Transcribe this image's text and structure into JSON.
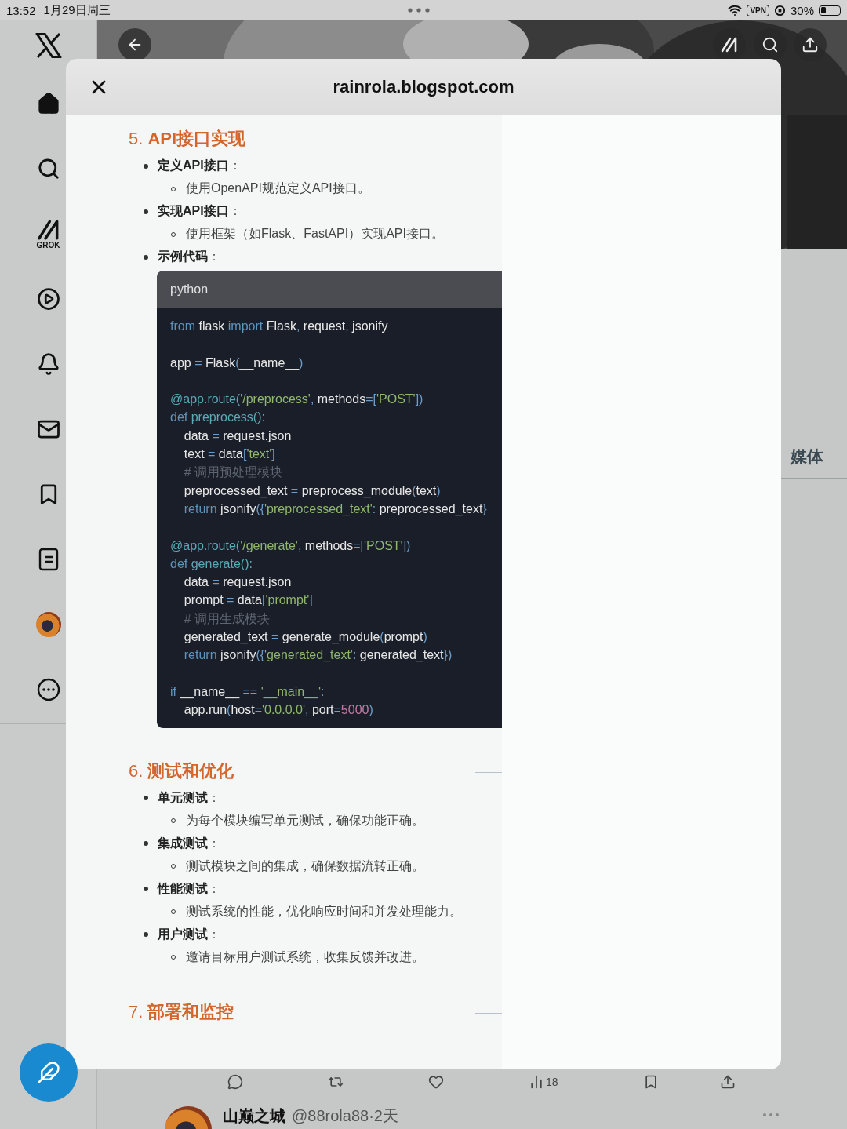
{
  "status_bar": {
    "time": "13:52",
    "date": "1月29日周三",
    "vpn": "VPN",
    "battery": "30%"
  },
  "sidebar": {
    "grok_label": "GROK"
  },
  "profile": {
    "tab": "媒体"
  },
  "tweet_actions": {
    "views": "18"
  },
  "next_tweet": {
    "author": "山巅之城",
    "handle_time": "@88rola88·2天"
  },
  "modal": {
    "title": "rainrola.blogspot.com",
    "sections": [
      {
        "heading": "5. **API接口实现**",
        "items": [
          {
            "label": "**定义API接口**：",
            "children": [
              {
                "text": "使用OpenAPI规范定义API接口。"
              }
            ]
          },
          {
            "label": "**实现API接口**：",
            "children": [
              {
                "text": "使用框架（如Flask、FastAPI）实现API接口。"
              }
            ]
          },
          {
            "label": "**示例代码**：",
            "code": {
              "language": "python",
              "lines": [
                {
                  "gap": false,
                  "tokens": [
                    {
                      "kind": "kw",
                      "text": "from"
                    },
                    {
                      "kind": "plain",
                      "text": " flask "
                    },
                    {
                      "kind": "kw",
                      "text": "import"
                    },
                    {
                      "kind": "plain",
                      "text": " Flask"
                    },
                    {
                      "kind": "op",
                      "text": ","
                    },
                    {
                      "kind": "plain",
                      "text": " request"
                    },
                    {
                      "kind": "op",
                      "text": ","
                    },
                    {
                      "kind": "plain",
                      "text": " jsonify"
                    }
                  ]
                },
                {
                  "gap": true,
                  "tokens": [
                    {
                      "kind": "plain",
                      "text": "app "
                    },
                    {
                      "kind": "op",
                      "text": "="
                    },
                    {
                      "kind": "plain",
                      "text": " Flask"
                    },
                    {
                      "kind": "op",
                      "text": "("
                    },
                    {
                      "kind": "plain",
                      "text": "__name__"
                    },
                    {
                      "kind": "op",
                      "text": ")"
                    }
                  ]
                },
                {
                  "gap": true,
                  "tokens": [
                    {
                      "kind": "fn",
                      "text": "@app.route("
                    },
                    {
                      "kind": "str",
                      "text": "'/preprocess'"
                    },
                    {
                      "kind": "op",
                      "text": ","
                    },
                    {
                      "kind": "plain",
                      "text": " methods"
                    },
                    {
                      "kind": "op",
                      "text": "=["
                    },
                    {
                      "kind": "str",
                      "text": "'POST'"
                    },
                    {
                      "kind": "op",
                      "text": "])"
                    }
                  ]
                },
                {
                  "gap": false,
                  "tokens": [
                    {
                      "kind": "kw",
                      "text": "def"
                    },
                    {
                      "kind": "fn",
                      "text": " preprocess():"
                    }
                  ]
                },
                {
                  "gap": false,
                  "tokens": [
                    {
                      "kind": "plain",
                      "text": "    data "
                    },
                    {
                      "kind": "op",
                      "text": "="
                    },
                    {
                      "kind": "plain",
                      "text": " request.json"
                    }
                  ]
                },
                {
                  "gap": false,
                  "tokens": [
                    {
                      "kind": "plain",
                      "text": "    text "
                    },
                    {
                      "kind": "op",
                      "text": "="
                    },
                    {
                      "kind": "plain",
                      "text": " data"
                    },
                    {
                      "kind": "op",
                      "text": "["
                    },
                    {
                      "kind": "str",
                      "text": "'text'"
                    },
                    {
                      "kind": "op",
                      "text": "]"
                    }
                  ]
                },
                {
                  "gap": false,
                  "tokens": [
                    {
                      "kind": "comment",
                      "text": "    # 调用预处理模块"
                    }
                  ]
                },
                {
                  "gap": false,
                  "tokens": [
                    {
                      "kind": "plain",
                      "text": "    preprocessed_text "
                    },
                    {
                      "kind": "op",
                      "text": "="
                    },
                    {
                      "kind": "plain",
                      "text": " preprocess_module"
                    },
                    {
                      "kind": "op",
                      "text": "("
                    },
                    {
                      "kind": "plain",
                      "text": "text"
                    },
                    {
                      "kind": "op",
                      "text": ")"
                    }
                  ]
                },
                {
                  "gap": false,
                  "tokens": [
                    {
                      "kind": "kw",
                      "text": "    return"
                    },
                    {
                      "kind": "plain",
                      "text": " jsonify"
                    },
                    {
                      "kind": "op",
                      "text": "({"
                    },
                    {
                      "kind": "str",
                      "text": "'preprocessed_text'"
                    },
                    {
                      "kind": "op",
                      "text": ":"
                    },
                    {
                      "kind": "plain",
                      "text": " preprocessed_text"
                    },
                    {
                      "kind": "op",
                      "text": "}"
                    }
                  ]
                },
                {
                  "gap": true,
                  "tokens": [
                    {
                      "kind": "fn",
                      "text": "@app.route("
                    },
                    {
                      "kind": "str",
                      "text": "'/generate'"
                    },
                    {
                      "kind": "op",
                      "text": ","
                    },
                    {
                      "kind": "plain",
                      "text": " methods"
                    },
                    {
                      "kind": "op",
                      "text": "=["
                    },
                    {
                      "kind": "str",
                      "text": "'POST'"
                    },
                    {
                      "kind": "op",
                      "text": "])"
                    }
                  ]
                },
                {
                  "gap": false,
                  "tokens": [
                    {
                      "kind": "kw",
                      "text": "def"
                    },
                    {
                      "kind": "fn",
                      "text": " generate():"
                    }
                  ]
                },
                {
                  "gap": false,
                  "tokens": [
                    {
                      "kind": "plain",
                      "text": "    data "
                    },
                    {
                      "kind": "op",
                      "text": "="
                    },
                    {
                      "kind": "plain",
                      "text": " request.json"
                    }
                  ]
                },
                {
                  "gap": false,
                  "tokens": [
                    {
                      "kind": "plain",
                      "text": "    prompt "
                    },
                    {
                      "kind": "op",
                      "text": "="
                    },
                    {
                      "kind": "plain",
                      "text": " data"
                    },
                    {
                      "kind": "op",
                      "text": "["
                    },
                    {
                      "kind": "str",
                      "text": "'prompt'"
                    },
                    {
                      "kind": "op",
                      "text": "]"
                    }
                  ]
                },
                {
                  "gap": false,
                  "tokens": [
                    {
                      "kind": "comment",
                      "text": "    # 调用生成模块"
                    }
                  ]
                },
                {
                  "gap": false,
                  "tokens": [
                    {
                      "kind": "plain",
                      "text": "    generated_text "
                    },
                    {
                      "kind": "op",
                      "text": "="
                    },
                    {
                      "kind": "plain",
                      "text": " generate_module"
                    },
                    {
                      "kind": "op",
                      "text": "("
                    },
                    {
                      "kind": "plain",
                      "text": "prompt"
                    },
                    {
                      "kind": "op",
                      "text": ")"
                    }
                  ]
                },
                {
                  "gap": false,
                  "tokens": [
                    {
                      "kind": "kw",
                      "text": "    return"
                    },
                    {
                      "kind": "plain",
                      "text": " jsonify"
                    },
                    {
                      "kind": "op",
                      "text": "({"
                    },
                    {
                      "kind": "str",
                      "text": "'generated_text'"
                    },
                    {
                      "kind": "op",
                      "text": ":"
                    },
                    {
                      "kind": "plain",
                      "text": " generated_text"
                    },
                    {
                      "kind": "op",
                      "text": "})"
                    }
                  ]
                },
                {
                  "gap": true,
                  "tokens": [
                    {
                      "kind": "kw",
                      "text": "if"
                    },
                    {
                      "kind": "plain",
                      "text": " __name__ "
                    },
                    {
                      "kind": "op",
                      "text": "=="
                    },
                    {
                      "kind": "str",
                      "text": " '__main__'"
                    },
                    {
                      "kind": "op",
                      "text": ":"
                    }
                  ]
                },
                {
                  "gap": false,
                  "tokens": [
                    {
                      "kind": "plain",
                      "text": "    app.run"
                    },
                    {
                      "kind": "op",
                      "text": "("
                    },
                    {
                      "kind": "plain",
                      "text": "host"
                    },
                    {
                      "kind": "op",
                      "text": "="
                    },
                    {
                      "kind": "str",
                      "text": "'0.0.0.0'"
                    },
                    {
                      "kind": "op",
                      "text": ","
                    },
                    {
                      "kind": "plain",
                      "text": " port"
                    },
                    {
                      "kind": "op",
                      "text": "="
                    },
                    {
                      "kind": "num",
                      "text": "5000"
                    },
                    {
                      "kind": "op",
                      "text": ")"
                    }
                  ]
                }
              ]
            }
          }
        ]
      },
      {
        "heading": "6. **测试和优化**",
        "items": [
          {
            "label": "**单元测试**：",
            "children": [
              {
                "text": "为每个模块编写单元测试，确保功能正确。"
              }
            ]
          },
          {
            "label": "**集成测试**：",
            "children": [
              {
                "text": "测试模块之间的集成，确保数据流转正确。"
              }
            ]
          },
          {
            "label": "**性能测试**：",
            "children": [
              {
                "text": "测试系统的性能，优化响应时间和并发处理能力。"
              }
            ]
          },
          {
            "label": "**用户测试**：",
            "children": [
              {
                "text": "邀请目标用户测试系统，收集反馈并改进。"
              }
            ]
          }
        ]
      },
      {
        "heading": "7. **部署和监控**"
      }
    ]
  }
}
